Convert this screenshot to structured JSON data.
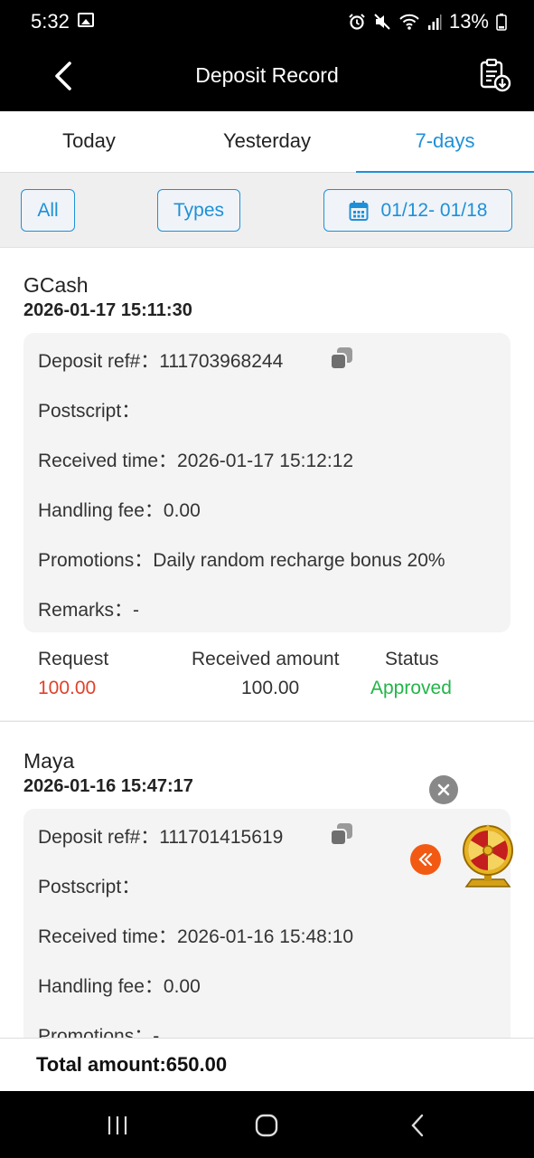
{
  "status_bar": {
    "time": "5:32",
    "battery": "13%"
  },
  "header": {
    "title": "Deposit Record"
  },
  "tabs": [
    {
      "label": "Today",
      "active": false
    },
    {
      "label": "Yesterday",
      "active": false
    },
    {
      "label": "7-days",
      "active": true
    }
  ],
  "filters": {
    "all_label": "All",
    "types_label": "Types",
    "date_range": "01/12- 01/18"
  },
  "records": [
    {
      "method": "GCash",
      "datetime": "2026-01-17 15:11:30",
      "deposit_ref": "Deposit ref#：111703968244",
      "postscript": "Postscript：",
      "received_time": "Received time：2026-01-17 15:12:12",
      "handling_fee": "Handling fee：0.00",
      "promotions": "Promotions：Daily random recharge bonus 20%",
      "remarks": "Remarks：-",
      "request_label": "Request",
      "request": "100.00",
      "received_label": "Received amount",
      "received": "100.00",
      "status_label": "Status",
      "status": "Approved"
    },
    {
      "method": "Maya",
      "datetime": "2026-01-16 15:47:17",
      "deposit_ref": "Deposit ref#：111701415619",
      "postscript": "Postscript：",
      "received_time": "Received time：2026-01-16 15:48:10",
      "handling_fee": "Handling fee：0.00",
      "promotions": "Promotions：-"
    }
  ],
  "total": "Total amount:650.00",
  "colors": {
    "accent": "#1e90d8",
    "request": "#e0412a",
    "approved": "#22b548",
    "floating_button": "#f25a14"
  },
  "icons": {
    "back": "chevron-left-icon",
    "download": "clipboard-download-icon",
    "calendar": "calendar-icon",
    "copy": "copy-icon",
    "close": "close-icon",
    "collapse": "double-chevron-left-icon",
    "wheel": "prize-wheel-icon"
  }
}
